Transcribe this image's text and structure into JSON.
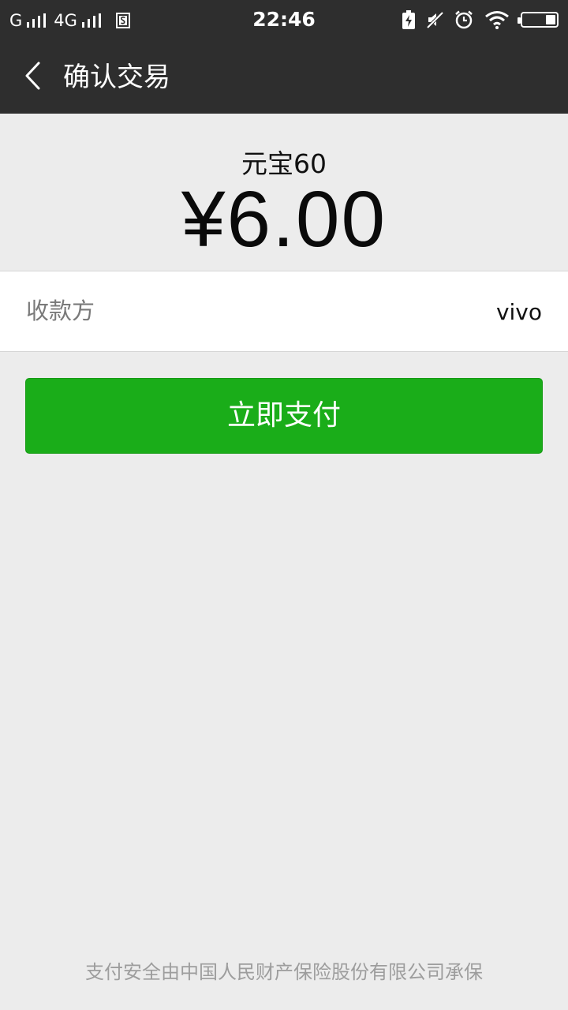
{
  "status_bar": {
    "signal_1_label": "G",
    "signal_2_label": "4G",
    "time": "22:46",
    "icons": [
      "sim-icon",
      "battery-charging-icon",
      "mute-icon",
      "alarm-icon",
      "wifi-icon",
      "battery-icon"
    ],
    "battery_level": 0.3
  },
  "nav": {
    "title": "确认交易"
  },
  "order": {
    "product_name": "元宝60",
    "amount": "¥6.00"
  },
  "payee": {
    "label": "收款方",
    "value": "vivo"
  },
  "actions": {
    "pay_label": "立即支付"
  },
  "footer": {
    "note": "支付安全由中国人民财产保险股份有限公司承保"
  },
  "colors": {
    "bar_background": "#2e2e2e",
    "page_background": "#ececec",
    "primary_button": "#1aad19"
  }
}
